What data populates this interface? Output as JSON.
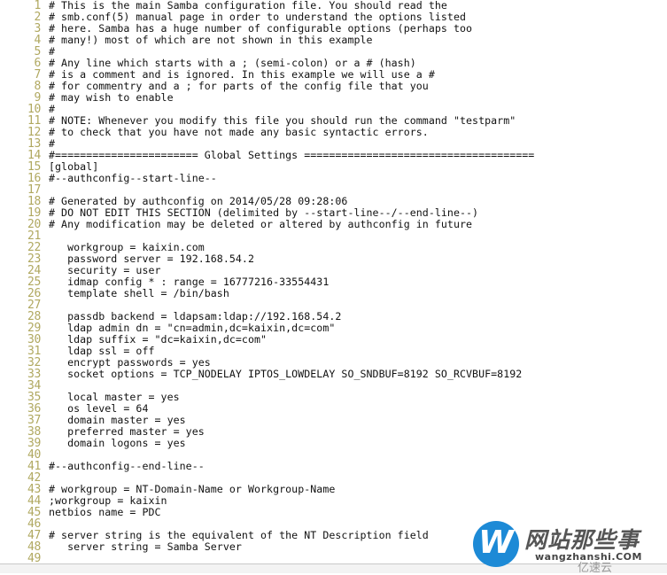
{
  "editor": {
    "lines": [
      {
        "n": "1",
        "text": "# This is the main Samba configuration file. You should read the"
      },
      {
        "n": "2",
        "text": "# smb.conf(5) manual page in order to understand the options listed"
      },
      {
        "n": "3",
        "text": "# here. Samba has a huge number of configurable options (perhaps too"
      },
      {
        "n": "4",
        "text": "# many!) most of which are not shown in this example"
      },
      {
        "n": "5",
        "text": "#"
      },
      {
        "n": "6",
        "text": "# Any line which starts with a ; (semi-colon) or a # (hash)"
      },
      {
        "n": "7",
        "text": "# is a comment and is ignored. In this example we will use a #"
      },
      {
        "n": "8",
        "text": "# for commentry and a ; for parts of the config file that you"
      },
      {
        "n": "9",
        "text": "# may wish to enable"
      },
      {
        "n": "10",
        "text": "#"
      },
      {
        "n": "11",
        "text": "# NOTE: Whenever you modify this file you should run the command \"testparm\""
      },
      {
        "n": "12",
        "text": "# to check that you have not made any basic syntactic errors."
      },
      {
        "n": "13",
        "text": "#"
      },
      {
        "n": "14",
        "text": "#======================= Global Settings ====================================="
      },
      {
        "n": "15",
        "text": "[global]"
      },
      {
        "n": "16",
        "text": "#--authconfig--start-line--"
      },
      {
        "n": "17",
        "text": ""
      },
      {
        "n": "18",
        "text": "# Generated by authconfig on 2014/05/28 09:28:06"
      },
      {
        "n": "19",
        "text": "# DO NOT EDIT THIS SECTION (delimited by --start-line--/--end-line--)"
      },
      {
        "n": "20",
        "text": "# Any modification may be deleted or altered by authconfig in future"
      },
      {
        "n": "21",
        "text": ""
      },
      {
        "n": "22",
        "text": "   workgroup = kaixin.com"
      },
      {
        "n": "23",
        "text": "   password server = 192.168.54.2"
      },
      {
        "n": "24",
        "text": "   security = user"
      },
      {
        "n": "25",
        "text": "   idmap config * : range = 16777216-33554431"
      },
      {
        "n": "26",
        "text": "   template shell = /bin/bash"
      },
      {
        "n": "27",
        "text": ""
      },
      {
        "n": "28",
        "text": "   passdb backend = ldapsam:ldap://192.168.54.2"
      },
      {
        "n": "29",
        "text": "   ldap admin dn = \"cn=admin,dc=kaixin,dc=com\""
      },
      {
        "n": "30",
        "text": "   ldap suffix = \"dc=kaixin,dc=com\""
      },
      {
        "n": "31",
        "text": "   ldap ssl = off"
      },
      {
        "n": "32",
        "text": "   encrypt passwords = yes"
      },
      {
        "n": "33",
        "text": "   socket options = TCP_NODELAY IPTOS_LOWDELAY SO_SNDBUF=8192 SO_RCVBUF=8192"
      },
      {
        "n": "34",
        "text": ""
      },
      {
        "n": "35",
        "text": "   local master = yes"
      },
      {
        "n": "36",
        "text": "   os level = 64"
      },
      {
        "n": "37",
        "text": "   domain master = yes"
      },
      {
        "n": "38",
        "text": "   preferred master = yes"
      },
      {
        "n": "39",
        "text": "   domain logons = yes"
      },
      {
        "n": "40",
        "text": ""
      },
      {
        "n": "41",
        "text": "#--authconfig--end-line--"
      },
      {
        "n": "42",
        "text": ""
      },
      {
        "n": "43",
        "text": "# workgroup = NT-Domain-Name or Workgroup-Name"
      },
      {
        "n": "44",
        "text": ";workgroup = kaixin"
      },
      {
        "n": "45",
        "text": "netbios name = PDC"
      },
      {
        "n": "46",
        "text": ""
      },
      {
        "n": "47",
        "text": "# server string is the equivalent of the NT Description field"
      },
      {
        "n": "48",
        "text": "   server string = Samba Server"
      },
      {
        "n": "49",
        "text": ""
      }
    ]
  },
  "watermark": {
    "logo_letter": "W",
    "title": "网站那些事",
    "url": "wangzhanshi.COM",
    "brand": "亿速云"
  }
}
